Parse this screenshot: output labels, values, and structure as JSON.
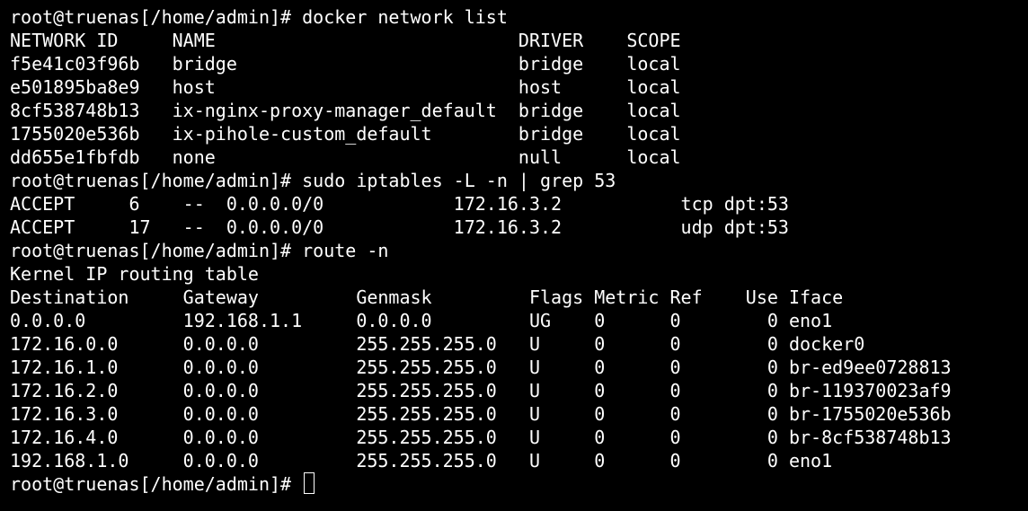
{
  "terminal": {
    "lines": [
      "root@truenas[/home/admin]# docker network list",
      "NETWORK ID     NAME                            DRIVER    SCOPE",
      "f5e41c03f96b   bridge                          bridge    local",
      "e501895ba8e9   host                            host      local",
      "8cf538748b13   ix-nginx-proxy-manager_default  bridge    local",
      "1755020e536b   ix-pihole-custom_default        bridge    local",
      "dd655e1fbfdb   none                            null      local",
      "root@truenas[/home/admin]# sudo iptables -L -n | grep 53",
      "ACCEPT     6    --  0.0.0.0/0            172.16.3.2           tcp dpt:53",
      "ACCEPT     17   --  0.0.0.0/0            172.16.3.2           udp dpt:53",
      "root@truenas[/home/admin]# route -n",
      "Kernel IP routing table",
      "Destination     Gateway         Genmask         Flags Metric Ref    Use Iface",
      "0.0.0.0         192.168.1.1     0.0.0.0         UG    0      0        0 eno1",
      "172.16.0.0      0.0.0.0         255.255.255.0   U     0      0        0 docker0",
      "172.16.1.0      0.0.0.0         255.255.255.0   U     0      0        0 br-ed9ee0728813",
      "172.16.2.0      0.0.0.0         255.255.255.0   U     0      0        0 br-119370023af9",
      "172.16.3.0      0.0.0.0         255.255.255.0   U     0      0        0 br-1755020e536b",
      "172.16.4.0      0.0.0.0         255.255.255.0   U     0      0        0 br-8cf538748b13",
      "192.168.1.0     0.0.0.0         255.255.255.0   U     0      0        0 eno1"
    ],
    "prompt": "root@truenas[/home/admin]# "
  },
  "colors": {
    "background": "#000000",
    "foreground": "#ffffff"
  }
}
